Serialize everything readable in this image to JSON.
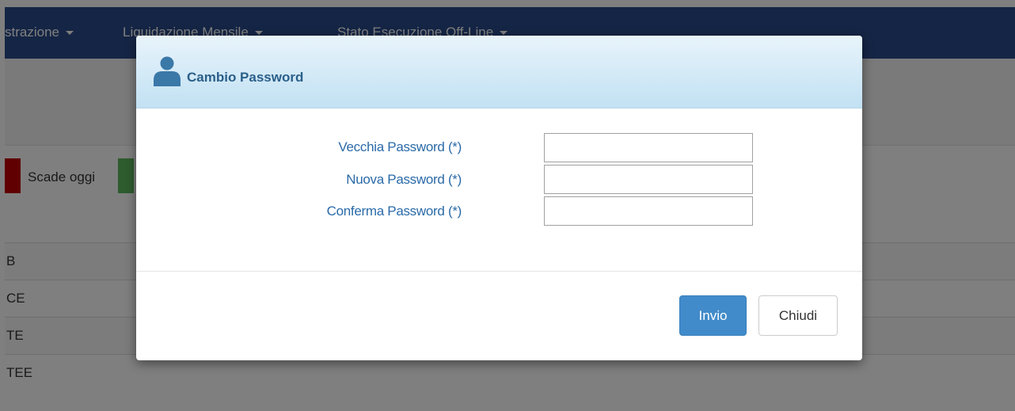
{
  "navbar": {
    "items": [
      {
        "label": "strazione"
      },
      {
        "label": "Liquidazione Mensile"
      },
      {
        "label": "Stato Esecuzione Off-Line"
      }
    ]
  },
  "legend": {
    "expired_color": "#c00000",
    "today_label": "Scade oggi",
    "today_color": "#5cb85c"
  },
  "table_rows": [
    {
      "text": "B"
    },
    {
      "text": "CE"
    },
    {
      "text": "TE"
    },
    {
      "text": "TEE"
    }
  ],
  "modal": {
    "icon": "user-icon",
    "title": "Cambio Password",
    "fields": [
      {
        "label": "Vecchia Password (*)",
        "value": ""
      },
      {
        "label": "Nuova Password (*)",
        "value": ""
      },
      {
        "label": "Conferma Password (*)",
        "value": ""
      }
    ],
    "submit_label": "Invio",
    "close_label": "Chiudi"
  },
  "colors": {
    "navbar": "#2a4a8a",
    "label_blue": "#2a6aa8",
    "primary": "#428bca"
  }
}
